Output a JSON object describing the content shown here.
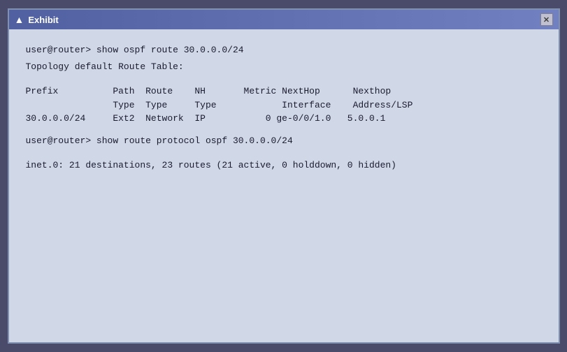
{
  "window": {
    "title": "Exhibit",
    "close_label": "✕"
  },
  "terminal": {
    "lines": [
      {
        "id": "cmd1",
        "text": "user@router> show ospf route 30.0.0.0/24"
      },
      {
        "id": "topology",
        "text": "Topology default Route Table:"
      },
      {
        "id": "blank1",
        "text": ""
      },
      {
        "id": "header1",
        "text": "Prefix          Path  Route    NH       Metric NextHop      Nexthop"
      },
      {
        "id": "header2",
        "text": "                Type  Type     Type            Interface    Address/LSP"
      },
      {
        "id": "row1",
        "text": "30.0.0.0/24     Ext2  Network  IP           0 ge-0/0/1.0   5.0.0.1"
      },
      {
        "id": "blank2",
        "text": ""
      },
      {
        "id": "cmd2",
        "text": "user@router> show route protocol ospf 30.0.0.0/24"
      },
      {
        "id": "blank3",
        "text": ""
      },
      {
        "id": "inet",
        "text": "inet.0: 21 destinations, 23 routes (21 active, 0 holddown, 0 hidden)"
      }
    ]
  }
}
